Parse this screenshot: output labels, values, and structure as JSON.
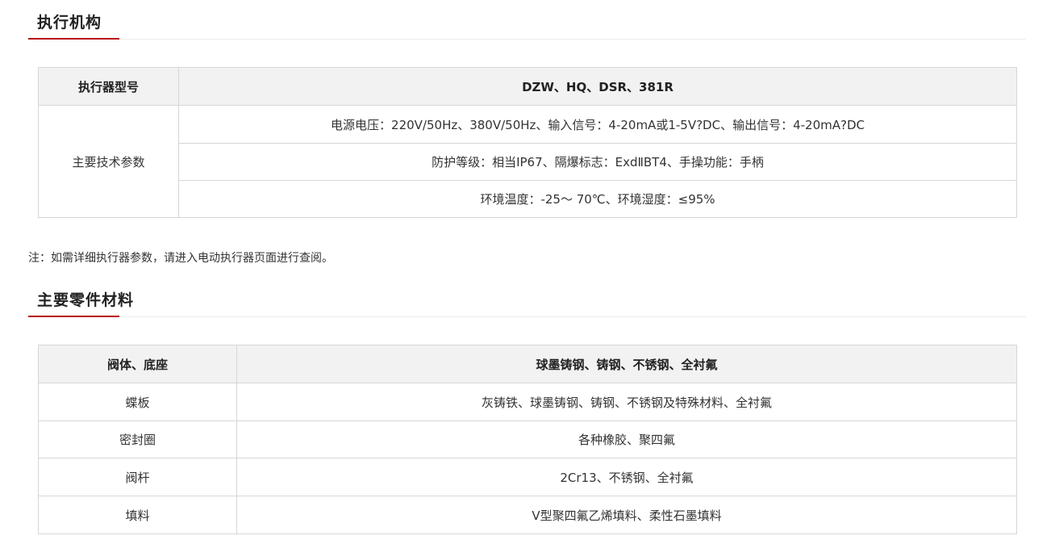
{
  "actuator_section": {
    "title": "执行机构",
    "table": {
      "model_label": "执行器型号",
      "model_value": "DZW、HQ、DSR、381R",
      "params_label": "主要技术参数",
      "params": [
        "电源电压：220V/50Hz、380V/50Hz、输入信号：4-20mA或1-5V?DC、输出信号：4-20mA?DC",
        "防护等级：相当IP67、隔爆标志：ExdⅡBT4、手操功能：手柄",
        "环境温度：-25～ 70℃、环境湿度：≤95%"
      ]
    }
  },
  "note": "注：如需详细执行器参数，请进入电动执行器页面进行查阅。",
  "materials_section": {
    "title": "主要零件材料",
    "header": {
      "part": "阀体、底座",
      "material": "球墨铸钢、铸钢、不锈钢、全衬氟"
    },
    "rows": [
      {
        "part": "蝶板",
        "material": "灰铸铁、球墨铸钢、铸钢、不锈钢及特殊材料、全衬氟"
      },
      {
        "part": "密封圈",
        "material": "各种橡胶、聚四氟"
      },
      {
        "part": "阀杆",
        "material": "2Cr13、不锈钢、全衬氟"
      },
      {
        "part": "填料",
        "material": "V型聚四氟乙烯填料、柔性石墨填料"
      }
    ]
  },
  "colors": {
    "accent": "#b80c0c",
    "header_bg": "#f2f2f2",
    "border": "#d6d6d6"
  }
}
